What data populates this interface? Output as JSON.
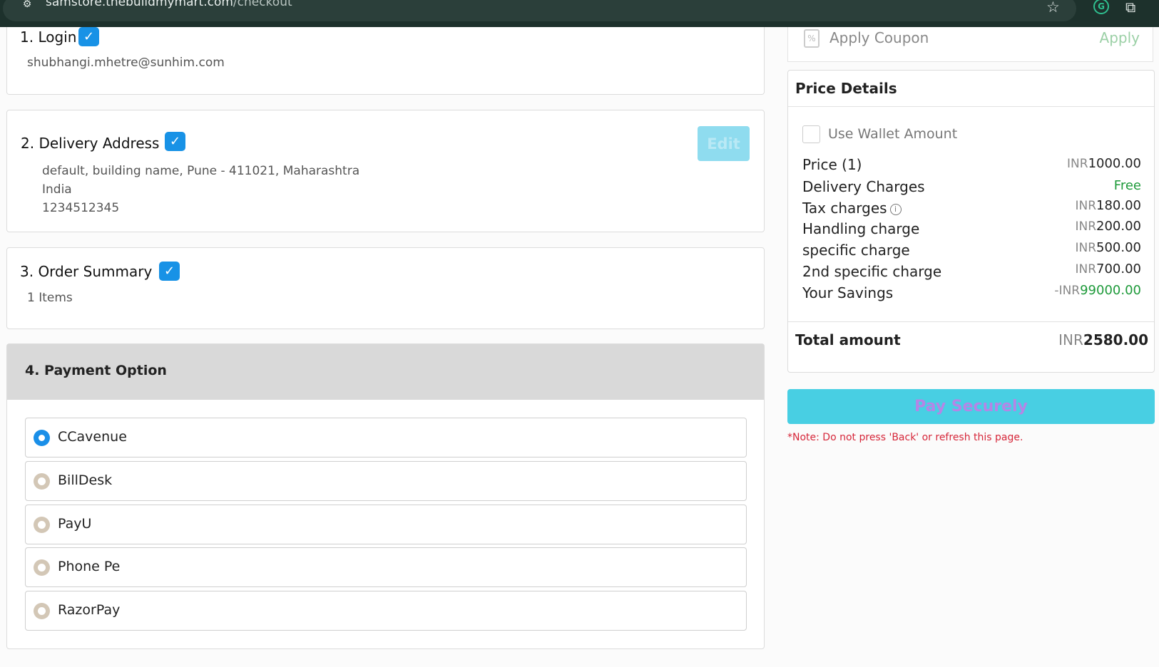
{
  "browser": {
    "url_host": "samstore.thebuildmymart.com",
    "url_path": "/checkout"
  },
  "steps": {
    "login": {
      "title": "1. Login",
      "email": "shubhangi.mhetre@sunhim.com"
    },
    "address": {
      "title": "2. Delivery Address",
      "edit_label": "Edit",
      "line1": "default, building name, Pune - 411021, Maharashtra",
      "line2": "India",
      "phone": "1234512345"
    },
    "summary": {
      "title": "3. Order Summary",
      "items": "1 Items"
    },
    "payment": {
      "title": "4. Payment Option",
      "options": [
        {
          "label": "CCavenue",
          "selected": true
        },
        {
          "label": "BillDesk",
          "selected": false
        },
        {
          "label": "PayU",
          "selected": false
        },
        {
          "label": "Phone Pe",
          "selected": false
        },
        {
          "label": "RazorPay",
          "selected": false
        }
      ]
    }
  },
  "coupon": {
    "label": "Apply Coupon",
    "apply_label": "Apply"
  },
  "price_details": {
    "title": "Price Details",
    "wallet_label": "Use Wallet Amount",
    "rows": [
      {
        "label": "Price (1)",
        "prefix": "",
        "currency": "INR",
        "amount": "1000.00"
      },
      {
        "label": "Delivery Charges",
        "prefix": "",
        "currency": "",
        "amount": "Free"
      },
      {
        "label": "Tax charges",
        "prefix": "",
        "currency": "INR",
        "amount": "180.00"
      },
      {
        "label": "Handling charge",
        "prefix": "",
        "currency": "INR",
        "amount": "200.00"
      },
      {
        "label": "specific charge",
        "prefix": "",
        "currency": "INR",
        "amount": "500.00"
      },
      {
        "label": "2nd specific charge",
        "prefix": "",
        "currency": "INR",
        "amount": "700.00"
      },
      {
        "label": "Your Savings",
        "prefix": "-",
        "currency": "INR",
        "amount": "99000.00"
      }
    ],
    "total_label": "Total amount",
    "total_currency": "INR",
    "total_amount": "2580.00"
  },
  "pay_button": "Pay Securely",
  "note": "*Note: Do not press 'Back' or refresh this page.",
  "colors": {
    "accent_blue": "#1892e6",
    "pay_button": "#48cfe3",
    "green": "#1e9a3a",
    "note_red": "#d6273a"
  }
}
